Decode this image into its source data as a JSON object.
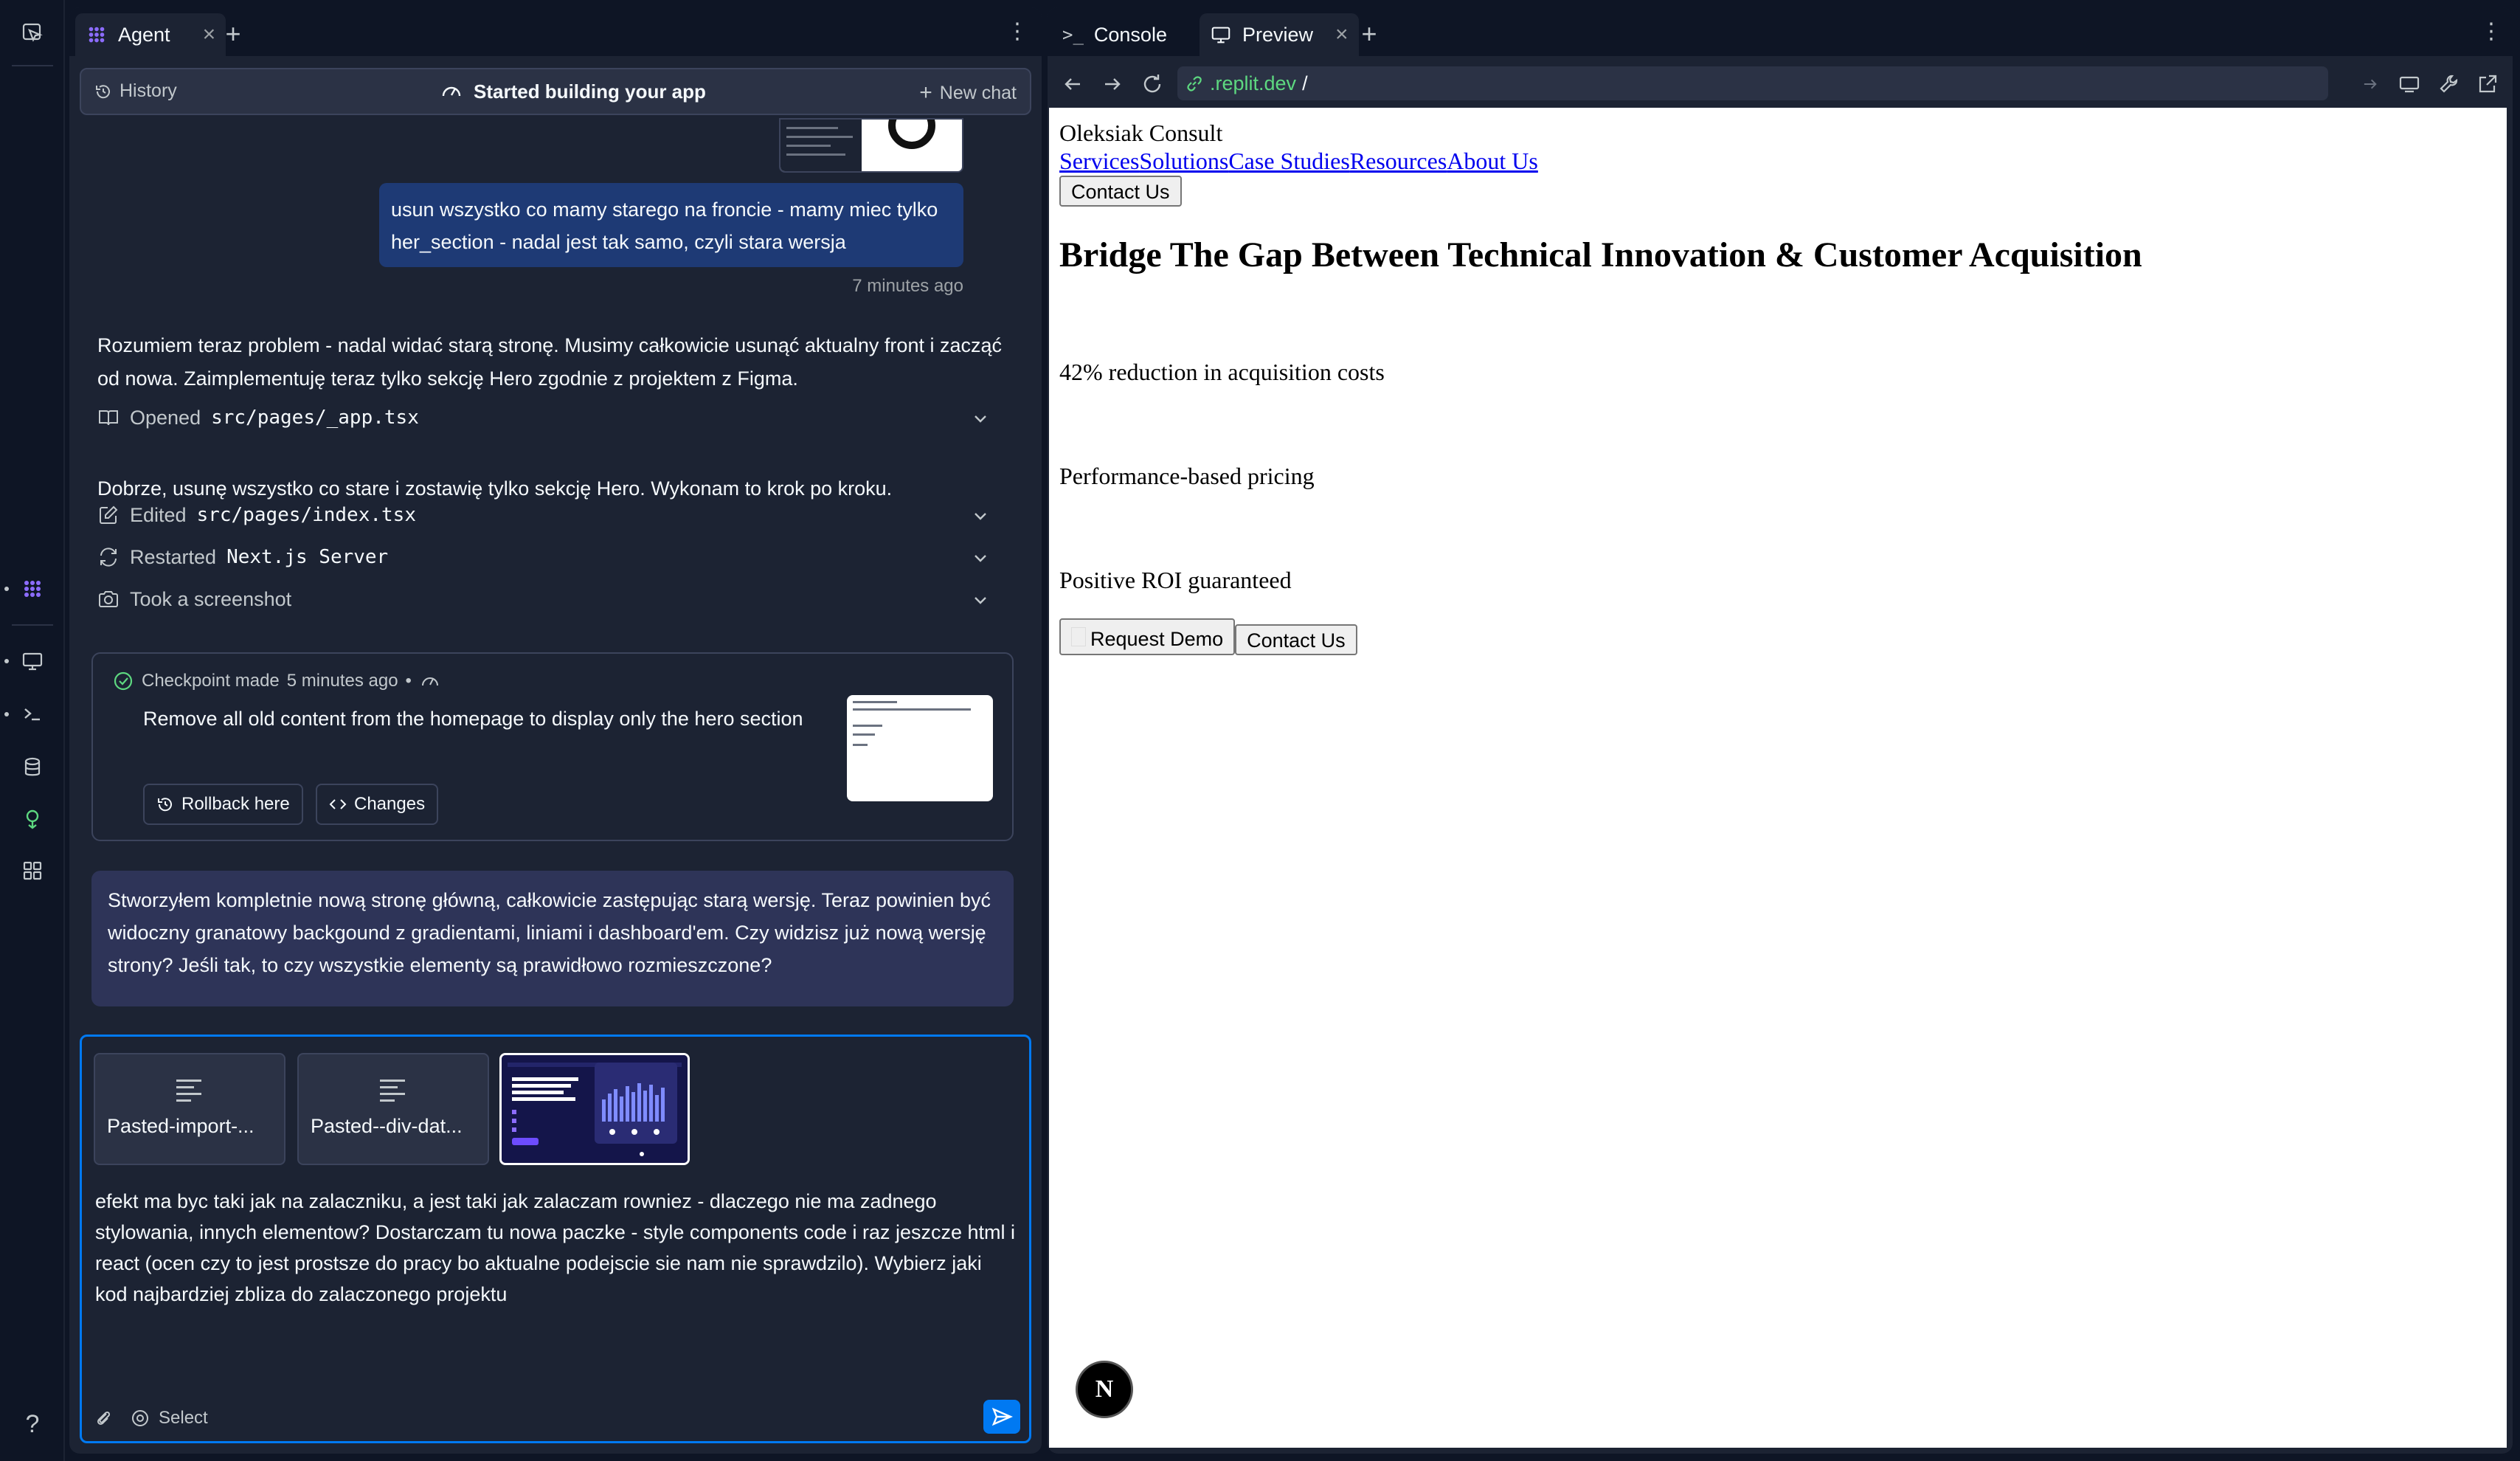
{
  "agent": {
    "tab_label": "Agent",
    "tab_close": "×",
    "add_tab": "+",
    "header": {
      "history": "History",
      "status": "Started building your app",
      "new_chat": "New chat"
    },
    "messages": {
      "user_message": "usun wszystko co mamy starego na froncie - mamy miec tylko her_section - nadal jest tak samo, czyli stara wersja",
      "user_time": "7 minutes ago",
      "agent_text_1": "Rozumiem teraz problem - nadal widać starą stronę. Musimy całkowicie usunąć aktualny front i zacząć od nowa. Zaimplementuję teraz tylko sekcję Hero zgodnie z projektem z Figma.",
      "action_opened": {
        "verb": "Opened",
        "target": "src/pages/_app.tsx"
      },
      "agent_text_2": "Dobrze, usunę wszystko co stare i zostawię tylko sekcję Hero. Wykonam to krok po kroku.",
      "action_edited": {
        "verb": "Edited",
        "target": "src/pages/index.tsx"
      },
      "action_restarted": {
        "verb": "Restarted",
        "target": "Next.js Server"
      },
      "action_screenshot": {
        "verb": "Took a screenshot"
      },
      "checkpoint": {
        "label": "Checkpoint made",
        "time": "5 minutes ago",
        "dot": "•",
        "description": "Remove all old content from the homepage to display only the hero section",
        "rollback": "Rollback here",
        "changes": "Changes"
      },
      "agent_bubble": "Stworzyłem kompletnie nową stronę główną, całkowicie zastępując starą wersję. Teraz powinien być widoczny granatowy backgound z gradientami, liniami i dashboard'em. Czy widzisz już nową wersję strony? Jeśli tak, to czy wszystkie elementy są prawidłowo rozmieszczone?"
    },
    "composer": {
      "attachments": [
        "Pasted-import-...",
        "Pasted--div-dat..."
      ],
      "prompt_text": "efekt ma byc taki jak na zalaczniku, a jest taki jak zalaczam rowniez - dlaczego nie ma zadnego stylowania, innych elementow? Dostarczam tu nowa paczke - style components code i raz jeszcze html i react  (ocen czy to jest prostsze do pracy bo aktualne podejscie sie nam nie sprawdzilo). Wybierz jaki kod najbardziej zbliza do zalaczonego projektu",
      "select_label": "Select"
    }
  },
  "right_panel": {
    "tabs": [
      {
        "label": "Console",
        "prefix": ">_"
      },
      {
        "label": "Preview"
      }
    ],
    "tab_close": "×",
    "add_tab": "+",
    "url": {
      "host": ".replit.dev",
      "path": "/"
    }
  },
  "preview_page": {
    "brand": "Oleksiak Consult",
    "nav": [
      "Services",
      "Solutions",
      "Case Studies",
      "Resources",
      "About Us"
    ],
    "contact_top": "Contact Us",
    "headline": "Bridge The Gap Between Technical Innovation & Customer Acquisition",
    "stats": [
      "42% reduction in acquisition costs",
      "Performance-based pricing",
      "Positive ROI guaranteed"
    ],
    "request_demo": "Request Demo",
    "contact_bottom": "Contact Us",
    "next_badge": "N"
  },
  "misc": {
    "help": "?"
  },
  "colors": {
    "bg": "#0e1525",
    "panel": "#1c2333",
    "accent": "#0079f2",
    "user_bubble": "#1e3a75",
    "agent_bubble": "#2e3458",
    "url_host": "#5dd880",
    "link": "#0000ee"
  }
}
